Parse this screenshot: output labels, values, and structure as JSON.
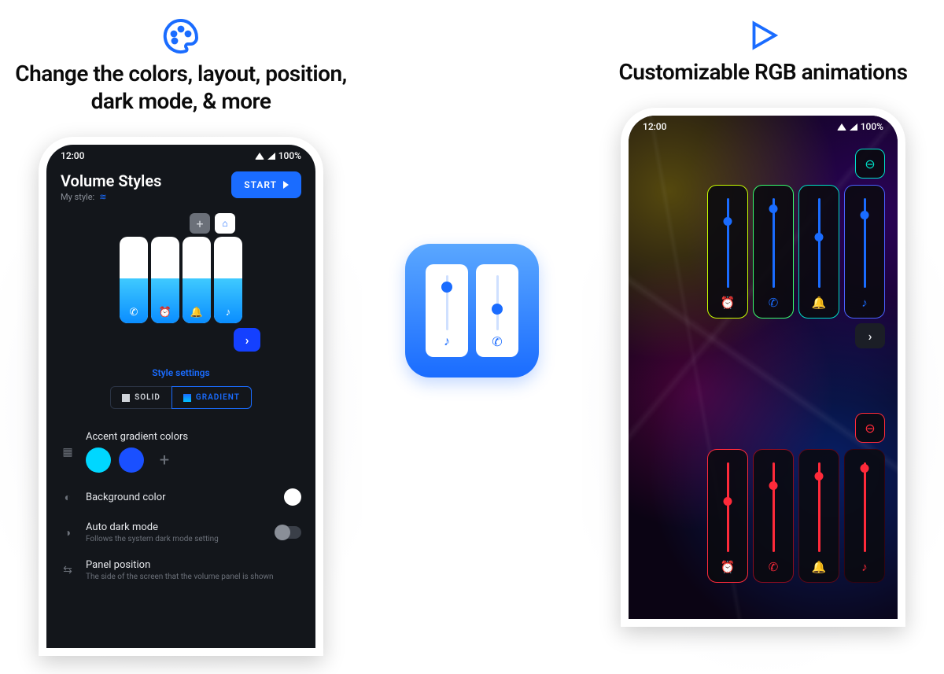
{
  "left": {
    "headline": "Change the colors, layout, position, dark mode, & more",
    "status": {
      "time": "12:00",
      "battery": "100%"
    },
    "app_title": "Volume Styles",
    "my_style_label": "My style:",
    "start_label": "START",
    "section_title": "Style settings",
    "seg_solid": "SOLID",
    "seg_gradient": "GRADIENT",
    "settings": {
      "accent_label": "Accent gradient colors",
      "accent_colors": [
        "#00d7ff",
        "#1a50ff"
      ],
      "bg_label": "Background color",
      "bg_value": "#ffffff",
      "auto_dark_label": "Auto dark mode",
      "auto_dark_sub": "Follows the system dark mode setting",
      "auto_dark_on": false,
      "panel_pos_label": "Panel position",
      "panel_pos_sub": "The side of the screen that the volume panel is shown"
    },
    "preview_icons": [
      "phone",
      "alarm",
      "bell",
      "music"
    ]
  },
  "right": {
    "headline": "Customizable RGB animations",
    "status": {
      "time": "12:00",
      "battery": "100%"
    },
    "groups": [
      {
        "color_scheme": "blue",
        "icons": [
          "alarm",
          "phone",
          "bell",
          "music"
        ]
      },
      {
        "color_scheme": "red",
        "icons": [
          "alarm",
          "phone",
          "bell",
          "music"
        ]
      }
    ]
  },
  "center": {
    "app_name": "Volume Styles app icon"
  }
}
